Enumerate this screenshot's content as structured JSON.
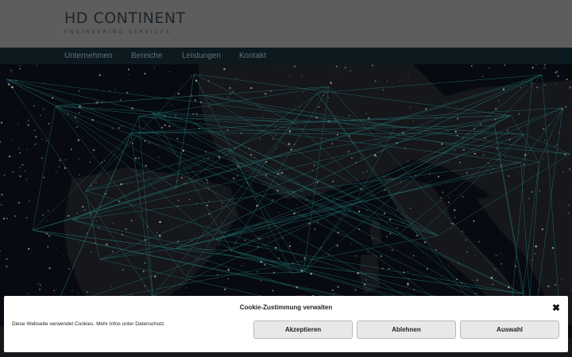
{
  "logo": {
    "title": "HD CONTINENT",
    "subtitle": "ENGINEERING SERVICES"
  },
  "nav": {
    "items": [
      {
        "label": "Unternehmen"
      },
      {
        "label": "Bereiche"
      },
      {
        "label": "Leistungen"
      },
      {
        "label": "Kontakt"
      }
    ]
  },
  "cookie": {
    "title": "Cookie-Zustimmung verwalten",
    "text": "Diese Webseite verwendet Cookies. Mehr Infos unter Datenschutz.",
    "accept_label": "Akzeptieren",
    "decline_label": "Ablehnen",
    "choose_label": "Auswahl",
    "close_glyph": "✖"
  },
  "colors": {
    "nav_bg": "#0c1a20",
    "header_bg": "#5d5d5d",
    "map_bg": "#070a10",
    "network_line": "#2fa3a0",
    "city_lights": "#c9c2a8"
  }
}
